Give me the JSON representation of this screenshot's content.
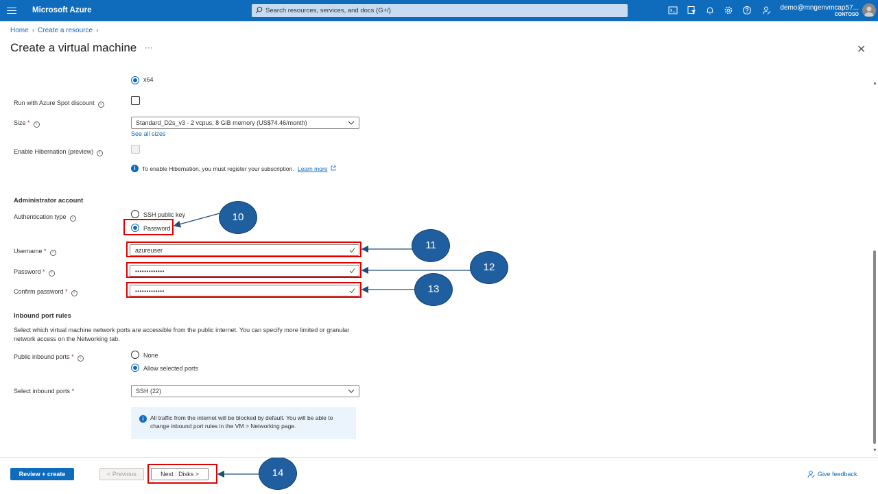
{
  "colors": {
    "topbar": "#0f6cbd",
    "highlight": "#e00000",
    "callout": "#1f5fa0",
    "link": "#0f6cbd"
  },
  "topbar": {
    "brand": "Microsoft Azure",
    "search_placeholder": "Search resources, services, and docs (G+/)",
    "user_email": "demo@mngenvmcap57...",
    "user_tenant": "CONTOSO",
    "icons": [
      "cloud-shell-icon",
      "directory-filter-icon",
      "notifications-icon",
      "settings-icon",
      "help-icon",
      "feedback-icon"
    ]
  },
  "breadcrumb": [
    "Home",
    "Create a resource"
  ],
  "page_title": "Create a virtual machine",
  "page_more": "···",
  "close": "✕",
  "form": {
    "arch_option": "x64",
    "spot_label": "Run with Azure Spot discount",
    "size_label": "Size",
    "size_value": "Standard_D2s_v3 - 2 vcpus, 8 GiB memory (US$74.46/month)",
    "see_all_sizes": "See all sizes",
    "hibernation_label": "Enable Hibernation (preview)",
    "hibernation_note": "To enable Hibernation, you must register your subscription.",
    "learn_more": "Learn more",
    "admin_heading": "Administrator account",
    "auth_label": "Authentication type",
    "auth_ssh": "SSH public key",
    "auth_password": "Password",
    "username_label": "Username",
    "username_value": "azureuser",
    "password_label": "Password",
    "password_value": "•••••••••••••",
    "confirm_label": "Confirm password",
    "confirm_value": "•••••••••••••",
    "inbound_heading": "Inbound port rules",
    "inbound_desc": "Select which virtual machine network ports are accessible from the public internet. You can specify more limited or granular network access on the Networking tab.",
    "public_ports_label": "Public inbound ports",
    "ports_none": "None",
    "ports_allow": "Allow selected ports",
    "select_ports_label": "Select inbound ports",
    "select_ports_value": "SSH (22)",
    "info_box_text": "All traffic from the internet will be blocked by default. You will be able to change inbound port rules in the VM > Networking page.",
    "required_mark": "*",
    "info_glyph": "i"
  },
  "callouts": [
    "10",
    "11",
    "12",
    "13",
    "14"
  ],
  "footer": {
    "review_create": "Review + create",
    "previous": "< Previous",
    "next": "Next : Disks >",
    "give_feedback": "Give feedback"
  }
}
